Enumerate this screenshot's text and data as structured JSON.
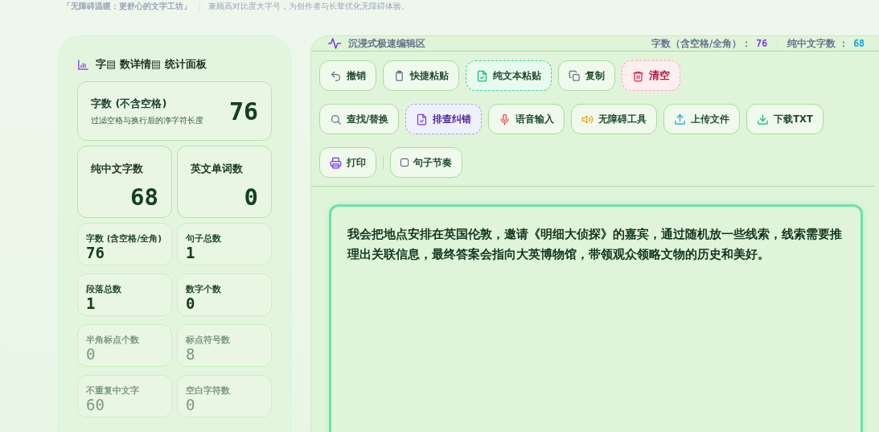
{
  "tagline": {
    "title": "「无障碍温暖：更舒心的文字工坊」",
    "subtitle": "兼顾高对比度大字号，为创作者与长辈优化无障碍体验。"
  },
  "stats_panel": {
    "title": "字▤ 数详情▤ 统计面板",
    "cards": [
      {
        "kind": "hero",
        "label": "字数 (不含空格)",
        "note": "过滤空格与换行后的净字符长度",
        "value": "76"
      },
      {
        "kind": "large",
        "label": "纯中文字数",
        "value": "68"
      },
      {
        "kind": "large",
        "label": "英文单词数",
        "value": "0"
      },
      {
        "kind": "small",
        "label": "字数 (含空格/全角)",
        "value": "76",
        "dimmed": false
      },
      {
        "kind": "small",
        "label": "句子总数",
        "value": "1",
        "dimmed": false
      },
      {
        "kind": "small",
        "label": "段落总数",
        "value": "1",
        "dimmed": false
      },
      {
        "kind": "small",
        "label": "数字个数",
        "value": "0",
        "dimmed": false
      },
      {
        "kind": "small",
        "label": "半角标点个数",
        "value": "0",
        "dimmed": true
      },
      {
        "kind": "small",
        "label": "标点符号数",
        "value": "8",
        "dimmed": true
      },
      {
        "kind": "small",
        "label": "不重复中文字",
        "value": "60",
        "dimmed": true
      },
      {
        "kind": "small",
        "label": "空白字符数",
        "value": "0",
        "dimmed": true
      }
    ]
  },
  "editor": {
    "title": "沉浸式极速编辑区",
    "counters": [
      {
        "label": "字数（含空格/全角）：",
        "value": "76",
        "color": "#7c3aed"
      },
      {
        "label": "纯中文字数 ：",
        "value": "68",
        "color": "#0ea5e9"
      }
    ],
    "toolbar": [
      {
        "kind": "plain",
        "label": "撤销"
      },
      {
        "kind": "plain",
        "label": "快捷粘贴"
      },
      {
        "kind": "dashed",
        "label": "纯文本粘贴"
      },
      {
        "kind": "plain",
        "label": "复制"
      },
      {
        "kind": "danger",
        "label": "清空"
      },
      {
        "kind": "plain",
        "label": "查找/替换"
      },
      {
        "kind": "accent",
        "label": "排查纠错"
      },
      {
        "kind": "plain",
        "label": "语音输入"
      },
      {
        "kind": "plain",
        "label": "无障碍工具"
      },
      {
        "kind": "plain",
        "label": "上传文件"
      },
      {
        "kind": "plain",
        "label": "下载TXT"
      },
      {
        "kind": "plain",
        "label": "打印"
      },
      {
        "kind": "checkbox",
        "label": "句子节奏",
        "checked": false
      }
    ],
    "value": "我会把地点安排在英国伦敦，邀请《明细大侦探》的嘉宾，通过随机放一些线索，线索需要推理出关联信息，最终答案会指向大英博物馆，带领观众领略文物的历史和美好。"
  }
}
